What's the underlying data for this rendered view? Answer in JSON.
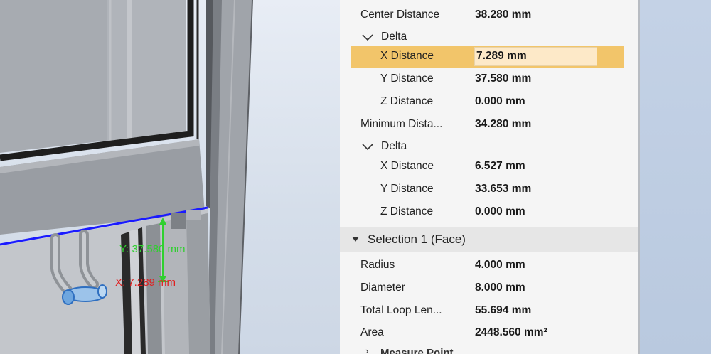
{
  "viewport": {
    "annotation_y": "Y: 37.580 mm",
    "annotation_x": "X: 7.289 mm",
    "colors": {
      "y_dim": "#2fd02f",
      "x_dim": "#e02020",
      "edge_highlight": "#1a1aff",
      "selected_face": "#5b9bd5"
    }
  },
  "measure": {
    "center_distance": {
      "label": "Center Distance",
      "value": "38.280 mm"
    },
    "delta1": {
      "label": "Delta",
      "x": {
        "label": "X Distance",
        "value": "7.289 mm"
      },
      "y": {
        "label": "Y Distance",
        "value": "37.580 mm"
      },
      "z": {
        "label": "Z Distance",
        "value": "0.000 mm"
      }
    },
    "minimum_distance": {
      "label": "Minimum Dista...",
      "value": "34.280 mm"
    },
    "delta2": {
      "label": "Delta",
      "x": {
        "label": "X Distance",
        "value": "6.527 mm"
      },
      "y": {
        "label": "Y Distance",
        "value": "33.653 mm"
      },
      "z": {
        "label": "Z Distance",
        "value": "0.000 mm"
      }
    }
  },
  "selection": {
    "title": "Selection 1 (Face)",
    "radius": {
      "label": "Radius",
      "value": "4.000 mm"
    },
    "diameter": {
      "label": "Diameter",
      "value": "8.000 mm"
    },
    "total_loop": {
      "label": "Total Loop Len...",
      "value": "55.694 mm"
    },
    "area": {
      "label": "Area",
      "value": "2448.560 mm²"
    }
  },
  "cutoff_item": {
    "label": "Measure Point"
  },
  "colors": {
    "selected_row": "#f2c56a",
    "edit_field": "#fde9c8",
    "panel_bg": "#f5f5f5",
    "section_header": "#e6e6e6"
  }
}
